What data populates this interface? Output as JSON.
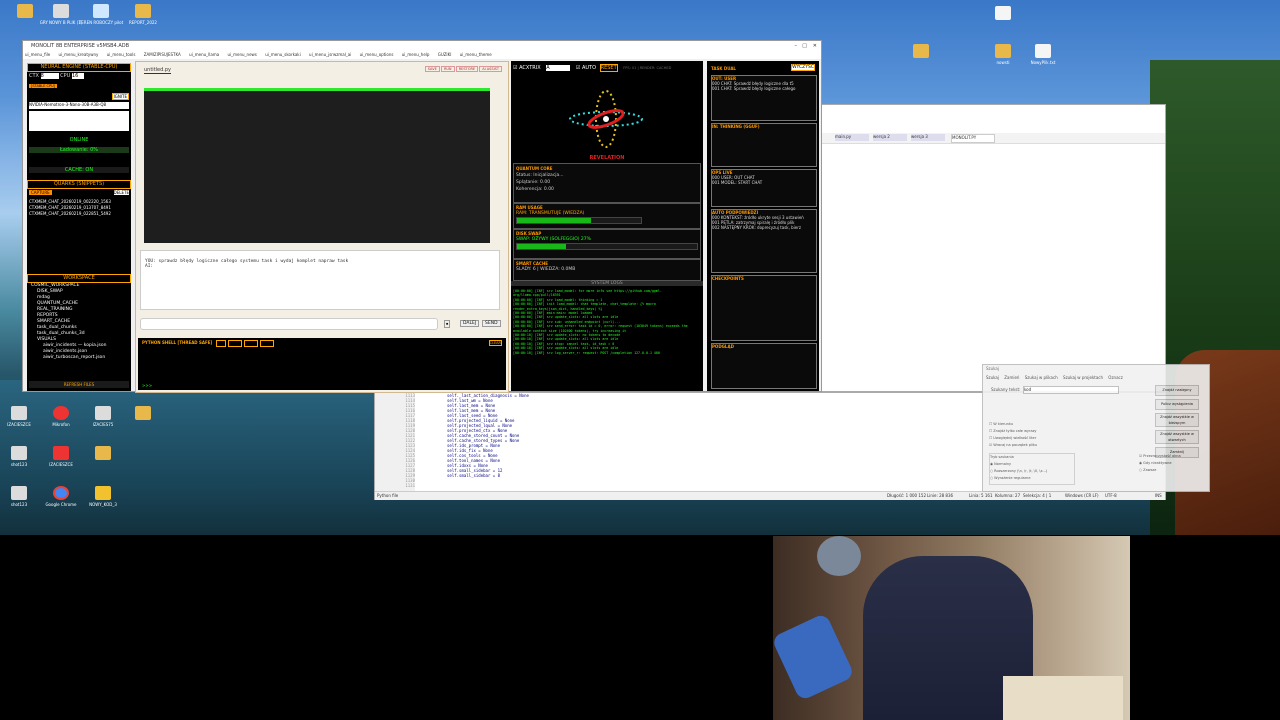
{
  "desktop": {
    "icons_left": [
      {
        "label": "",
        "color": "#e8b84a"
      },
      {
        "label": "GRY NOWY B PLIK (1)",
        "color": "#dcdcdc"
      },
      {
        "label": "TEREN ROBOCZY pilot",
        "color": "#cfe8ff"
      },
      {
        "label": "REPORT_2022",
        "color": "#e8b84a"
      }
    ],
    "icons_bottom": [
      {
        "label": "IZACIESZCE",
        "color": "#dcdcdc"
      },
      {
        "label": "Mikrofon",
        "color": "#e33"
      },
      {
        "label": "IZACIES75",
        "color": "#dcdcdc"
      },
      {
        "label": "Google Chrome",
        "color": "#e8b84a"
      },
      {
        "label": "shot123",
        "color": "#dcdcdc"
      },
      {
        "label": "Google Chrome",
        "color": "#4285f4"
      },
      {
        "label": "NOWY_KOD_3",
        "color": "#f2c12e"
      }
    ],
    "icons_right": [
      {
        "label": "",
        "color": "#e8b84a"
      },
      {
        "label": "nowsti",
        "color": "#e8b84a"
      },
      {
        "label": "NowyPlik.txt",
        "color": "#f5f5f5"
      },
      {
        "label": "",
        "color": "#f5f5f5"
      }
    ]
  },
  "app": {
    "title": "MONOLIT 8B ENTERPRISE v5MSB4.ADB",
    "menu": [
      "ui_menu_file",
      "ui_menu_kreatywny",
      "ui_menu_tools",
      "ZAMIZIPISUJESTKA",
      "ui_menu_llama",
      "ui_menu_news",
      "ui_menu_skorkaki",
      "ui_menu_jsrwzmal_ai",
      "ui_menu_options",
      "ui_menu_help",
      "GUZIKI",
      "ui_menu_theme"
    ],
    "left": {
      "engine_header": "NEURAL ENGINE (STABLE-CPU)",
      "ctx_label": "CTX",
      "ctx_value": "8",
      "cpu_label": "CPU",
      "cpu_value": "16",
      "stable_badge": "[STABLE CPU]",
      "ignite_label": "IGNITE",
      "model_name": "NVIDIA-Nemotron-3-Nano-30B-A3B-Q8",
      "online_label": "ONLINE",
      "loading_label": "Ładowanie: 0%",
      "cache_label": "CACHE: ON",
      "quarks_header": "QUARKS (SNIPPETS)",
      "capture_label": "CAPTURE",
      "delete_label": "DELETE",
      "snippets": [
        "CTXMEM_CHAT_20260219_002220_1563",
        "CTXMEM_CHAT_20260219_013707_8491",
        "CTXMEM_CHAT_20260219_022851_5492"
      ],
      "workspace_header": "WORKSPACE",
      "tree": [
        "COSMIC_WORKSPACE",
        "DISK_SWAP",
        "mdag",
        "QUANTUM_CACHE",
        "REAL_TRAINING",
        "REPORTS",
        "SMART_CACHE",
        "task_dual_chunks",
        "task_dual_chunks_3d",
        "VISUALS",
        "aiwir_incidents — kopia.json",
        "aiwir_incidents.json",
        "aiwir_turboscan_report.json"
      ],
      "refresh_label": "REFRESH FILES"
    },
    "editor": {
      "tab": "untitled.py",
      "buttons": [
        "SAVE",
        "RUN",
        "RESTORE",
        "AI ASSIST"
      ],
      "prompt_text": "YOU: sprawdz błędy logiczne całego systemu task i wydaj komplet napraw task",
      "ai_text": "AI:",
      "input_value": "",
      "dalej_label": "DALEJ",
      "send_label": "SEND",
      "shell_header": "PYTHON SHELL [THREAD SAFE]",
      "shell_clear": "CLEAR",
      "shell_prompt": ">>>"
    },
    "mid": {
      "tab": "ACXTRIX",
      "tab_value": "A",
      "auto_label": "AUTO",
      "reset_label": "RESET",
      "status_small": "FPS: 01 | RENDER: CACHED",
      "revelation": "REVELATION",
      "quantum_title": "QUANTUM CORE",
      "quantum_status": "Status: Inicjalizacja...",
      "quantum_entangle": "Splątanie: 0.00",
      "quantum_coherence": "Koherencja: 0.00",
      "ram_title": "RAM USAGE",
      "ram_text": "RAM: TRANSMUTUJE (WIEDZA)",
      "ram_fill": 0.6,
      "swap_title": "DISK SWAP",
      "swap_text": "SWAP: OŻYWY (SOLFEGGIO) 27%",
      "swap_fill": 0.27,
      "smart_title": "SMART CACHE",
      "smart_text": "ŚLADY: 6 | WIEDZA: 0.0MB",
      "logs_title": "SYSTEM LOGS",
      "logs": [
        "[00:00:00] [INF] srv    load_model: for more info see https://github.com/ggml-org/llama.cpp/pull/16391",
        "[00:00:00] [INF] srv    load_model: thinking = 1",
        "[00:00:00] [INF] init   load_model: chat template, chat_template: {% macro render_extra_keys(json_dict, handled_keys) %}",
        "[00:00:00] [INF] main   main: model loaded",
        "[00:00:00] [INF] srv    update_slots: all slots are idle",
        "[00:00:00] [INF] srv    sub: unhandled endpoint (curl)...",
        "[00:00:00] [INF] srv    send_error: task id = 0, error: request (103049 tokens) exceeds the available context size (102400 tokens), try increasing it",
        "[00:00:10] [INF] srv    update_slots: no tokens to decode",
        "[00:00:10] [INF] srv    update_slots: all slots are idle",
        "[00:00:10] [INF] srv    stop: cancel task, id_task = 0",
        "[00:00:10] [INF] srv    update_slots: all slots are idle",
        "[00:00:10] [INF] srv    log_server_r: request: POST /completion 127.0.0.1 400"
      ]
    },
    "right": {
      "task_dual": "TASK DUAL",
      "clear_label": "WYCZYŚĆ",
      "out_user": "OUT: USER",
      "out_lines": [
        "000 CHAT: Sprawdź błędy logiczne dla t5",
        "001 CHAT: Sprawdź błędy logiczne całego"
      ],
      "thinking": "IN: THINKING (GGUF)",
      "ops_live": "OPS LIVE",
      "ops_lines": [
        "000 USER: OUT CHAT",
        "001 MODEL: START CHAT"
      ],
      "auto_hints": "AUTO PODPOWIEDZI",
      "hint_lines": [
        "000 KONTEKST: źródło ukryte sesji 3 ustawień",
        "001 PĘTLA: zatrzymaj spiralę i źródło plik",
        "002 NASTĘPNY KROK: doprecyzuj task, bierz"
      ],
      "checkpoints": "CHECKPOINTS",
      "podglad": "PODGLĄD"
    }
  },
  "ide": {
    "lines_start": 1113,
    "code": [
      "self._last_action_diagnosis = None",
      "self.last_wm = None",
      "self.last_mem = None",
      "self.last_mem = None",
      "self.last_seed = None",
      "self.projected_liquid = None",
      "self.projected_lqual = None",
      "self.projected_ctx = None",
      "self.cache_stored_count = None",
      "self.cache_stored_types = None",
      "self.ids_prompt = None",
      "self.ids_fix = None",
      "",
      "self.cos_tools = None",
      "self.tool_names = None",
      "self.idxxs = None",
      "",
      "self.small_sidebar = 12",
      "self.small_sidebar = 8"
    ],
    "status_left": "Python file",
    "status_length": "Długość: 1 000 152",
    "status_lines": "Linie: 28 836",
    "status_pos": "Linia: 5 161",
    "status_col": "Kolumna: 27",
    "status_sel": "Selekcja: 4 | 1",
    "status_eol": "Windows (CR LF)",
    "status_enc": "UTF-8",
    "status_ins": "INS"
  },
  "browser": {
    "tabs": [
      "main.py",
      "wersja 2",
      "wersja 3",
      "MONOLIT.PY"
    ]
  },
  "dialog": {
    "title": "Szukaj",
    "tabs": [
      "Szukaj",
      "Zamień",
      "Szukaj w plikach",
      "Szukaj w projektach",
      "Oznacz"
    ],
    "find_label": "Szukany tekst:",
    "find_value": "kod",
    "buttons": [
      "Znajdź następny",
      "Policz wystąpienia",
      "Znajdź wszystkie w bieżącym",
      "Znajdź wszystkie w otwartych",
      "Zamknij"
    ],
    "options": [
      "W kierunku",
      "Znajdź tylko całe wyrazy",
      "Uwzględnij wielkość liter",
      "Wracaj na początek pliku"
    ],
    "mode_label": "Tryb szukania",
    "modes": [
      "Normalny",
      "Rozszerzony (\\n, \\r, \\t, \\0, \\x...)",
      "Wyrażenie regularne"
    ],
    "transparency_label": "Przezroczystość okna",
    "transparency_opts": [
      "Gdy nieaktywne",
      "Zawsze"
    ]
  }
}
